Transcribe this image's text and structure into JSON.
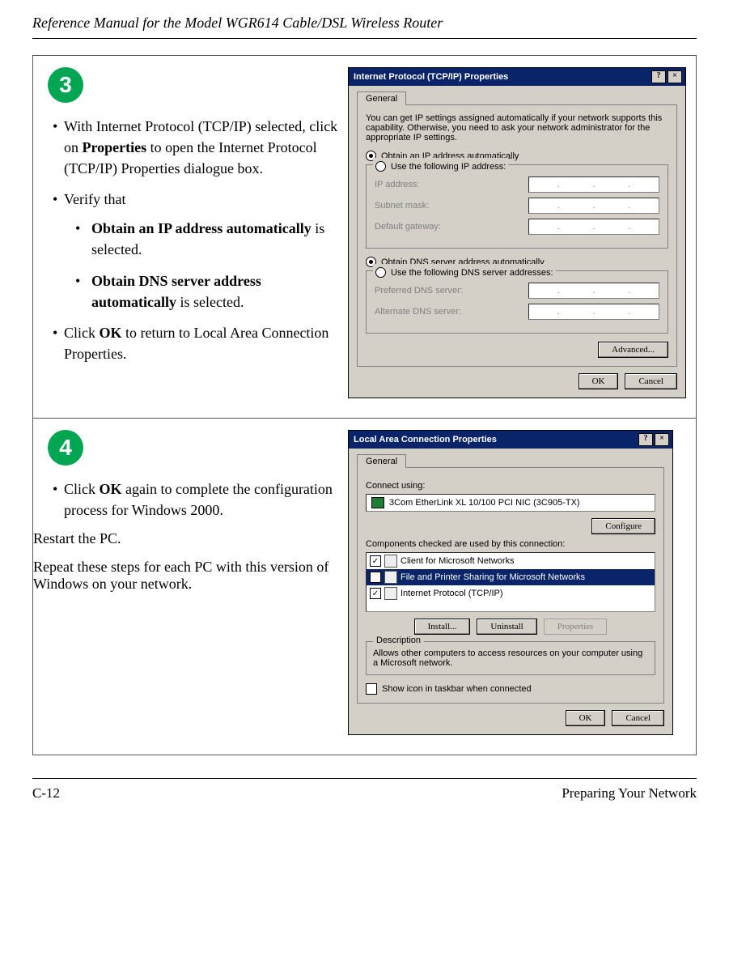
{
  "header": {
    "title": "Reference Manual for the Model WGR614 Cable/DSL Wireless Router"
  },
  "step3": {
    "number": "3",
    "li1_a": "With Internet Protocol (TCP/IP) selected, click on ",
    "li1_b": "Properties",
    "li1_c": " to open the Internet Protocol (TCP/IP) Properties dialogue box.",
    "li2": "Verify that",
    "li2a_a": "Obtain an IP address automatically",
    "li2a_b": " is selected.",
    "li2b_a": "Obtain DNS server address automatically",
    "li2b_b": " is selected.",
    "li3_a": "Click ",
    "li3_b": "OK",
    "li3_c": " to return to Local Area Connection Properties."
  },
  "step4": {
    "number": "4",
    "li1_a": "Click ",
    "li1_b": "OK",
    "li1_c": " again to complete the configuration process for Windows 2000.",
    "para1": "Restart the PC.",
    "para2": "Repeat these steps for each PC with this version of Windows on your network."
  },
  "dlg1": {
    "title": "Internet Protocol (TCP/IP) Properties",
    "help": "?",
    "close": "×",
    "tab": "General",
    "desc": "You can get IP settings assigned automatically if your network supports this capability. Otherwise, you need to ask your network administrator for the appropriate IP settings.",
    "r1": "Obtain an IP address automatically",
    "r2": "Use the following IP address:",
    "ip_label": "IP address:",
    "subnet_label": "Subnet mask:",
    "gateway_label": "Default gateway:",
    "r3": "Obtain DNS server address automatically",
    "r4": "Use the following DNS server addresses:",
    "pref_label": "Preferred DNS server:",
    "alt_label": "Alternate DNS server:",
    "advanced": "Advanced...",
    "ok": "OK",
    "cancel": "Cancel"
  },
  "dlg2": {
    "title": "Local Area Connection Properties",
    "help": "?",
    "close": "×",
    "tab": "General",
    "connect_using": "Connect using:",
    "nic": "3Com EtherLink XL 10/100 PCI NIC (3C905-TX)",
    "configure": "Configure",
    "components_lbl": "Components checked are used by this connection:",
    "c1": "Client for Microsoft Networks",
    "c2": "File and Printer Sharing for Microsoft Networks",
    "c3": "Internet Protocol (TCP/IP)",
    "install": "Install...",
    "uninstall": "Uninstall",
    "properties": "Properties",
    "desc_hdr": "Description",
    "desc_txt": "Allows other computers to access resources on your computer using a Microsoft network.",
    "show_icon": "Show icon in taskbar when connected",
    "ok": "OK",
    "cancel": "Cancel"
  },
  "footer": {
    "page": "C-12",
    "section": "Preparing Your Network"
  }
}
